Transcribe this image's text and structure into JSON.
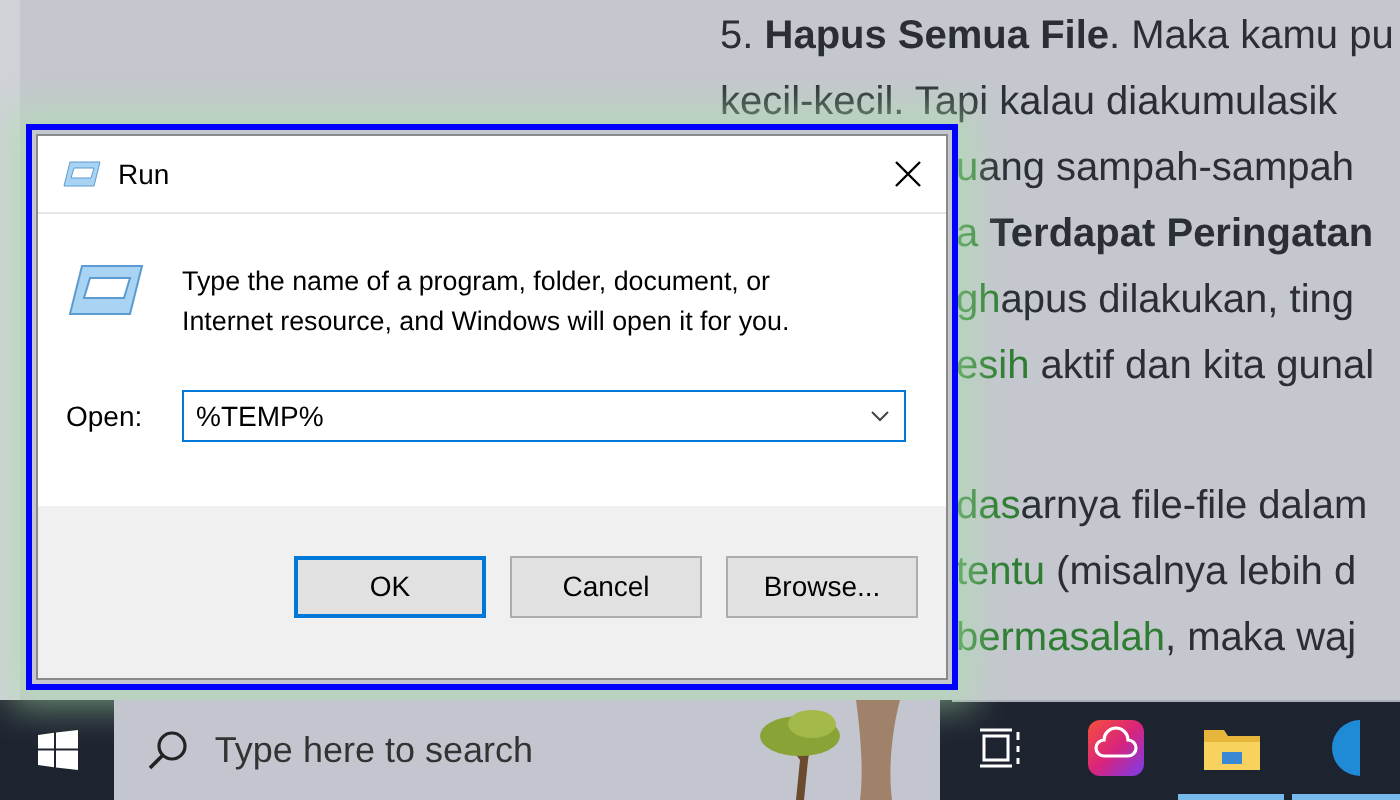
{
  "article": {
    "top_lines": [
      {
        "parts": [
          {
            "kind": "text",
            "text": "5. "
          },
          {
            "kind": "bold",
            "text": "Hapus Semua File"
          },
          {
            "kind": "text",
            "text": ". Maka kamu pu"
          }
        ]
      },
      {
        "parts": [
          {
            "kind": "text",
            "text": "kecil-kecil. Tapi kalau diakumulasik"
          }
        ]
      }
    ],
    "side_paragraphs": [
      {
        "lines": [
          {
            "parts": [
              {
                "kind": "link",
                "text": "u"
              },
              {
                "kind": "text",
                "text": "ang sampah-sampah"
              }
            ]
          },
          {
            "parts": [
              {
                "kind": "link",
                "text": "a "
              },
              {
                "kind": "bold",
                "text": "Terdapat Peringatan"
              }
            ]
          },
          {
            "parts": [
              {
                "kind": "link",
                "text": "gh"
              },
              {
                "kind": "text",
                "text": "apus dilakukan, ting"
              }
            ]
          },
          {
            "parts": [
              {
                "kind": "link",
                "text": "esih"
              },
              {
                "kind": "text",
                "text": " aktif dan kita gunal"
              }
            ]
          }
        ]
      },
      {
        "lines": [
          {
            "parts": [
              {
                "kind": "link",
                "text": "das"
              },
              {
                "kind": "text",
                "text": "arnya file-file dalam"
              }
            ]
          },
          {
            "parts": [
              {
                "kind": "link",
                "text": "tentu"
              },
              {
                "kind": "text",
                "text": " (misalnya lebih d"
              }
            ]
          },
          {
            "parts": [
              {
                "kind": "link",
                "text": "bermasalah"
              },
              {
                "kind": "text",
                "text": ", maka waj"
              }
            ]
          }
        ]
      }
    ]
  },
  "run_dialog": {
    "title": "Run",
    "message": "Type the name of a program, folder, document, or Internet resource, and Windows will open it for you.",
    "open_label": "Open:",
    "open_value": "%TEMP%",
    "buttons": [
      {
        "label": "OK",
        "focused": true
      },
      {
        "label": "Cancel",
        "focused": false
      },
      {
        "label": "Browse...",
        "focused": false
      }
    ]
  },
  "taskbar": {
    "search_placeholder": "Type here to search",
    "apps": [
      {
        "kind": "task-view",
        "running": false
      },
      {
        "kind": "creative-cloud",
        "running": false
      },
      {
        "kind": "folder",
        "running": true
      },
      {
        "kind": "browser",
        "running": true
      }
    ]
  }
}
